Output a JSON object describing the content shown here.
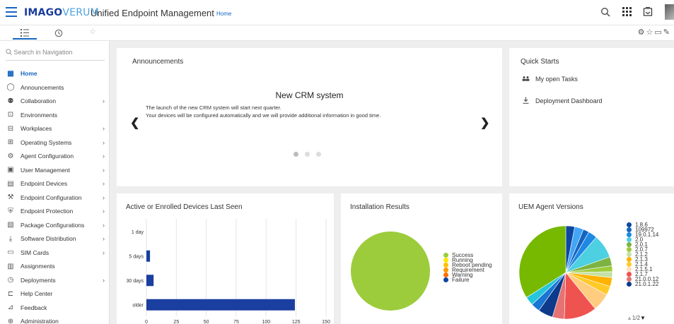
{
  "header": {
    "logo_part1": "IMAGO",
    "logo_part2": "VERUM",
    "app_title": "Unified Endpoint Management",
    "breadcrumb": "Home"
  },
  "navigation": {
    "search_placeholder": "Search in Navigation",
    "items": [
      {
        "label": "Home",
        "icon": "home-grid-icon",
        "active": true,
        "submenu": false
      },
      {
        "label": "Announcements",
        "icon": "chat-bubble-icon",
        "submenu": false
      },
      {
        "label": "Collaboration",
        "icon": "people-icon",
        "submenu": true
      },
      {
        "label": "Environments",
        "icon": "environment-icon",
        "submenu": false
      },
      {
        "label": "Workplaces",
        "icon": "workplace-icon",
        "submenu": true
      },
      {
        "label": "Operating Systems",
        "icon": "os-download-icon",
        "submenu": true
      },
      {
        "label": "Agent Configuration",
        "icon": "agent-icon",
        "submenu": true
      },
      {
        "label": "User Management",
        "icon": "user-card-icon",
        "submenu": true
      },
      {
        "label": "Endpoint Devices",
        "icon": "devices-icon",
        "submenu": true
      },
      {
        "label": "Endpoint Configuration",
        "icon": "wrench-icon",
        "submenu": true
      },
      {
        "label": "Endpoint Protection",
        "icon": "shield-icon",
        "submenu": true
      },
      {
        "label": "Package Configurations",
        "icon": "package-icon",
        "submenu": true
      },
      {
        "label": "Software Distribution",
        "icon": "download-icon",
        "submenu": true
      },
      {
        "label": "SIM Cards",
        "icon": "sim-card-icon",
        "submenu": true
      },
      {
        "label": "Assignments",
        "icon": "assignment-icon",
        "submenu": false
      },
      {
        "label": "Deployments",
        "icon": "clock-icon",
        "submenu": true
      },
      {
        "label": "Help Center",
        "icon": "help-book-icon",
        "submenu": false
      },
      {
        "label": "Feedback",
        "icon": "feedback-icon",
        "submenu": false
      },
      {
        "label": "Administration",
        "icon": "admin-icon",
        "submenu": false
      }
    ]
  },
  "announcements": {
    "title": "Announcements",
    "heading": "New CRM system",
    "line1": "The launch of the new CRM system will start next quarter.",
    "line2": "Your devices will be configured automatically and we will provide additional information in good time.",
    "slide_count": 3,
    "active_slide": 1
  },
  "quick_starts": {
    "title": "Quick Starts",
    "items": [
      {
        "label": "My open Tasks",
        "icon": "people-icon"
      },
      {
        "label": "Deployment Dashboard",
        "icon": "download-icon"
      }
    ]
  },
  "devices_chart": {
    "title": "Active or Enrolled Devices Last Seen"
  },
  "installation_chart": {
    "title": "Installation Results"
  },
  "agent_chart": {
    "title": "UEM Agent Versions",
    "pagination": "1/2"
  },
  "chart_data": [
    {
      "type": "bar",
      "orientation": "horizontal",
      "title": "Active or Enrolled Devices Last Seen",
      "categories": [
        "1 day",
        "5 days",
        "30 days",
        "older"
      ],
      "values": [
        0,
        3,
        6,
        124
      ],
      "xlim": [
        0,
        150
      ],
      "xticks": [
        0,
        25,
        50,
        75,
        100,
        125,
        150
      ],
      "color": "#1a3fa0",
      "grid": true
    },
    {
      "type": "pie",
      "title": "Installation Results",
      "legend_position": "right",
      "labels": [
        "Success",
        "Running",
        "Reboot pending",
        "Requirement",
        "Warning",
        "Failure"
      ],
      "colors": [
        "#9ccc3c",
        "#ffe600",
        "#ffc107",
        "#ff9800",
        "#ff6f00",
        "#0d47a1"
      ],
      "values": [
        100,
        0,
        0,
        0,
        0,
        0
      ]
    },
    {
      "type": "pie",
      "title": "UEM Agent Versions",
      "legend_position": "right",
      "labels": [
        "1.8.6",
        "109972",
        "19.0.1.14",
        "2.0",
        "2.0.1",
        "2.0.7",
        "2.1.2",
        "2.1.3",
        "2.1.4",
        "2.1.5.1",
        "2.1.7",
        "21.0.0.12",
        "21.0.1.22"
      ],
      "colors": [
        "#0d47a1",
        "#1565c0",
        "#1e88e5",
        "#4dd0e1",
        "#7cb342",
        "#9ccc3c",
        "#c5e1a5",
        "#ffb300",
        "#ffca28",
        "#ffe0b2",
        "#ef5350",
        "#e57373",
        "#0d3a8a"
      ],
      "values": [
        3,
        2,
        3,
        8,
        3,
        2,
        2,
        3,
        3,
        3,
        11,
        4,
        5
      ],
      "extra_slices": [
        {
          "color": "#ffcc80",
          "value": 6
        },
        {
          "color": "#42a5f5",
          "value": 3
        },
        {
          "color": "#1976d2",
          "value": 3
        },
        {
          "color": "#26c6da",
          "value": 3
        },
        {
          "color": "#76b900",
          "value": 33
        }
      ]
    }
  ]
}
